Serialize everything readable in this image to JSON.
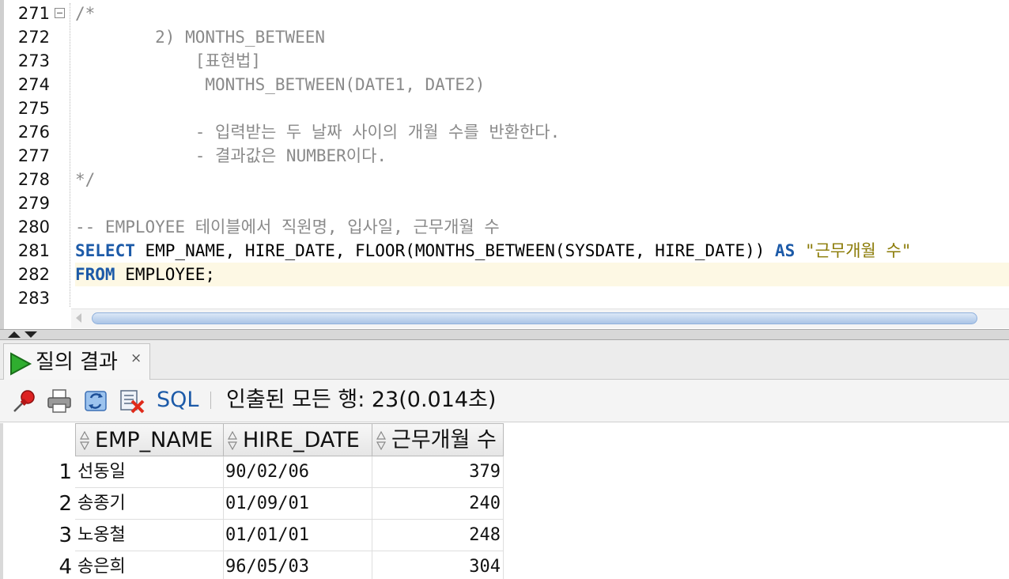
{
  "editor": {
    "line_numbers": [
      "271",
      "272",
      "273",
      "274",
      "275",
      "276",
      "277",
      "278",
      "279",
      "280",
      "281",
      "282",
      "283"
    ],
    "lines": {
      "l271": "/*",
      "l272": "        2) MONTHS_BETWEEN",
      "l273": "            [표현법]",
      "l274": "             MONTHS_BETWEEN(DATE1, DATE2)",
      "l275": "",
      "l276": "            - 입력받는 두 날짜 사이의 개월 수를 반환한다.",
      "l277": "            - 결과값은 NUMBER이다.",
      "l278": "*/",
      "l279": "",
      "l280": "-- EMPLOYEE 테이블에서 직원명, 입사일, 근무개월 수",
      "l281_kw1": "SELECT",
      "l281_body": " EMP_NAME, HIRE_DATE, FLOOR(MONTHS_BETWEEN(SYSDATE, HIRE_DATE)) ",
      "l281_kw2": "AS",
      "l281_str": " \"근무개월 수\"",
      "l282_kw": "FROM",
      "l282_body": " EMPLOYEE;",
      "l283": ""
    },
    "current_line": "282"
  },
  "results": {
    "tab_label": "질의 결과",
    "tab_close": "×",
    "toolbar": {
      "icons": [
        "pin-icon",
        "print-icon",
        "refresh-icon",
        "clear-icon"
      ],
      "sql_label": "SQL",
      "status": "인출된 모든 행: 23(0.014초)"
    },
    "columns": [
      "EMP_NAME",
      "HIRE_DATE",
      "근무개월 수"
    ],
    "rows": [
      {
        "num": "1",
        "name": "선동일",
        "hire": "90/02/06",
        "months": "379"
      },
      {
        "num": "2",
        "name": "송종기",
        "hire": "01/09/01",
        "months": "240"
      },
      {
        "num": "3",
        "name": "노옹철",
        "hire": "01/01/01",
        "months": "248"
      },
      {
        "num": "4",
        "name": "송은희",
        "hire": "96/05/03",
        "months": "304"
      }
    ]
  },
  "colors": {
    "keyword": "#1c5aa8",
    "comment": "#8a8a8a",
    "string": "#8a7a05",
    "current_line_bg": "#fdf8e4"
  }
}
